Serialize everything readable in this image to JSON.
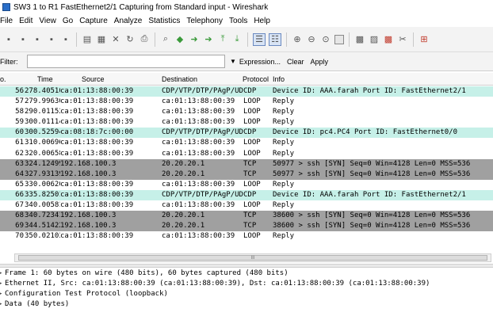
{
  "window": {
    "title": "SW3 1 to R1 FastEthernet2/1 Capturing from Standard input - Wireshark"
  },
  "menu": [
    "File",
    "Edit",
    "View",
    "Go",
    "Capture",
    "Analyze",
    "Statistics",
    "Telephony",
    "Tools",
    "Help"
  ],
  "toolbar_icons": [
    "interface-list-icon",
    "capture-options-icon",
    "start-capture-icon",
    "stop-capture-icon",
    "restart-capture-icon",
    "open-file-icon",
    "save-file-icon",
    "close-file-icon",
    "reload-icon",
    "print-icon",
    "find-packet-icon",
    "go-back-icon",
    "go-forward-icon",
    "go-to-packet-icon",
    "go-first-icon",
    "go-last-icon",
    "colorize-icon",
    "auto-scroll-icon",
    "zoom-in-icon",
    "zoom-out-icon",
    "normal-size-icon",
    "resize-columns-icon",
    "capture-filters-icon",
    "display-filters-icon",
    "coloring-rules-icon",
    "preferences-icon",
    "help-icon"
  ],
  "filter": {
    "label": "Filter:",
    "value": "",
    "expression": "Expression...",
    "clear": "Clear",
    "apply": "Apply"
  },
  "columns": {
    "no": "o.",
    "time": "Time",
    "source": "Source",
    "destination": "Destination",
    "protocol": "Protocol",
    "info": "Info"
  },
  "packets": [
    {
      "no": "56",
      "time": "278.405103",
      "src": "ca:01:13:88:00:39",
      "dst": "CDP/VTP/DTP/PAgP/UD",
      "proto": "CDP",
      "info": "Device ID: AAA.farah  Port ID: FastEthernet2/1",
      "bg": "#c6f0e8"
    },
    {
      "no": "57",
      "time": "279.996305",
      "src": "ca:01:13:88:00:39",
      "dst": "ca:01:13:88:00:39",
      "proto": "LOOP",
      "info": "Reply",
      "bg": "#ffffff"
    },
    {
      "no": "58",
      "time": "290.011523",
      "src": "ca:01:13:88:00:39",
      "dst": "ca:01:13:88:00:39",
      "proto": "LOOP",
      "info": "Reply",
      "bg": "#ffffff"
    },
    {
      "no": "59",
      "time": "300.011141",
      "src": "ca:01:13:88:00:39",
      "dst": "ca:01:13:88:00:39",
      "proto": "LOOP",
      "info": "Reply",
      "bg": "#ffffff"
    },
    {
      "no": "60",
      "time": "300.525942",
      "src": "ca:08:18:7c:00:00",
      "dst": "CDP/VTP/DTP/PAgP/UD",
      "proto": "CDP",
      "info": "Device ID: pc4.PC4  Port ID: FastEthernet0/0",
      "bg": "#c6f0e8"
    },
    {
      "no": "61",
      "time": "310.006965",
      "src": "ca:01:13:88:00:39",
      "dst": "ca:01:13:88:00:39",
      "proto": "LOOP",
      "info": "Reply",
      "bg": "#ffffff"
    },
    {
      "no": "62",
      "time": "320.006582",
      "src": "ca:01:13:88:00:39",
      "dst": "ca:01:13:88:00:39",
      "proto": "LOOP",
      "info": "Reply",
      "bg": "#ffffff"
    },
    {
      "no": "63",
      "time": "324.124990",
      "src": "192.168.100.3",
      "dst": "20.20.20.1",
      "proto": "TCP",
      "info": "50977 > ssh [SYN] Seq=0 Win=4128 Len=0 MSS=536",
      "bg": "#a0a0a0"
    },
    {
      "no": "64",
      "time": "327.931396",
      "src": "192.168.100.3",
      "dst": "20.20.20.1",
      "proto": "TCP",
      "info": "50977 > ssh [SYN] Seq=0 Win=4128 Len=0 MSS=536",
      "bg": "#a0a0a0"
    },
    {
      "no": "65",
      "time": "330.006200",
      "src": "ca:01:13:88:00:39",
      "dst": "ca:01:13:88:00:39",
      "proto": "LOOP",
      "info": "Reply",
      "bg": "#ffffff"
    },
    {
      "no": "66",
      "time": "335.825010",
      "src": "ca:01:13:88:00:39",
      "dst": "CDP/VTP/DTP/PAgP/UD",
      "proto": "CDP",
      "info": "Device ID: AAA.farah  Port ID: FastEthernet2/1",
      "bg": "#c6f0e8"
    },
    {
      "no": "67",
      "time": "340.005818",
      "src": "ca:01:13:88:00:39",
      "dst": "ca:01:13:88:00:39",
      "proto": "LOOP",
      "info": "Reply",
      "bg": "#ffffff"
    },
    {
      "no": "68",
      "time": "340.723419",
      "src": "192.168.100.3",
      "dst": "20.20.20.1",
      "proto": "TCP",
      "info": "38600 > ssh [SYN] Seq=0 Win=4128 Len=0 MSS=536",
      "bg": "#a0a0a0"
    },
    {
      "no": "69",
      "time": "344.514226",
      "src": "192.168.100.3",
      "dst": "20.20.20.1",
      "proto": "TCP",
      "info": "38600 > ssh [SYN] Seq=0 Win=4128 Len=0 MSS=536",
      "bg": "#a0a0a0"
    },
    {
      "no": "70",
      "time": "350.021035",
      "src": "ca:01:13:88:00:39",
      "dst": "ca:01:13:88:00:39",
      "proto": "LOOP",
      "info": "Reply",
      "bg": "#ffffff"
    }
  ],
  "scrollbar": {
    "thumb_grip": "III"
  },
  "details": [
    "Frame 1: 60 bytes on wire (480 bits), 60 bytes captured (480 bits)",
    "Ethernet II, Src: ca:01:13:88:00:39 (ca:01:13:88:00:39), Dst: ca:01:13:88:00:39 (ca:01:13:88:00:39)",
    "Configuration Test Protocol (loopback)",
    "Data (40 bytes)"
  ],
  "details_expander": "▸"
}
